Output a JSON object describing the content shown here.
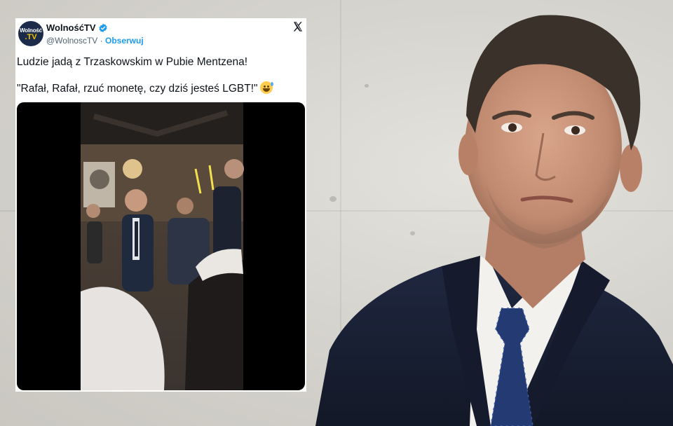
{
  "tweet": {
    "display_name": "WolnośćTV",
    "handle": "@WolnoscTV",
    "separator": " · ",
    "follow_label": "Obserwuj",
    "avatar": {
      "line1": "Wolność",
      "line2": ".TV"
    },
    "text_line1": "Ludzie jadą z Trzaskowskim w Pubie Mentzena!",
    "text_line2": "\"Rafał, Rafał, rzuć monetę, czy dziś jesteś LGBT!\"",
    "emoji": "grinning-face-with-sweat",
    "colors": {
      "accent": "#1d9bf0",
      "text": "#0f1419",
      "muted": "#536471",
      "brand_yellow": "#f2c200"
    }
  },
  "icons": {
    "verified": "verified-badge-icon",
    "platform": "x-logo-icon"
  }
}
